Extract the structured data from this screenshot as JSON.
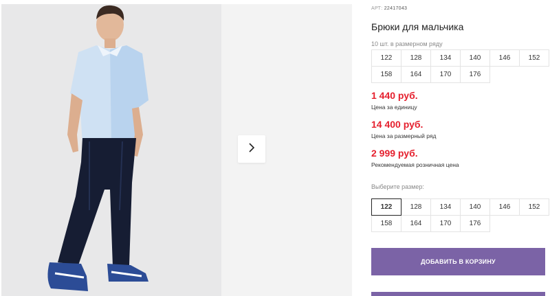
{
  "product": {
    "article_label": "АРТ:",
    "article_number": "22417043",
    "title": "Брюки для мальчика",
    "pack_note": "10 шт. в размерном ряду"
  },
  "size_range": [
    "122",
    "128",
    "134",
    "140",
    "146",
    "152",
    "158",
    "164",
    "170",
    "176"
  ],
  "prices": {
    "unit_price": "1 440 руб.",
    "unit_label": "Цена за единицу",
    "range_price": "14 400 руб.",
    "range_label": "Цена за размерный ряд",
    "retail_price": "2 999 руб.",
    "retail_label": "Рекомендуемая розничная цена"
  },
  "size_picker": {
    "label": "Выберите размер:",
    "options": [
      "122",
      "128",
      "134",
      "140",
      "146",
      "152",
      "158",
      "164",
      "170",
      "176"
    ],
    "selected": "122"
  },
  "actions": {
    "add_to_cart": "Добавить в корзину"
  },
  "gallery": {
    "next_icon": "chevron-right-icon"
  },
  "colors": {
    "price": "#e5202e",
    "button": "#7b63a6"
  }
}
